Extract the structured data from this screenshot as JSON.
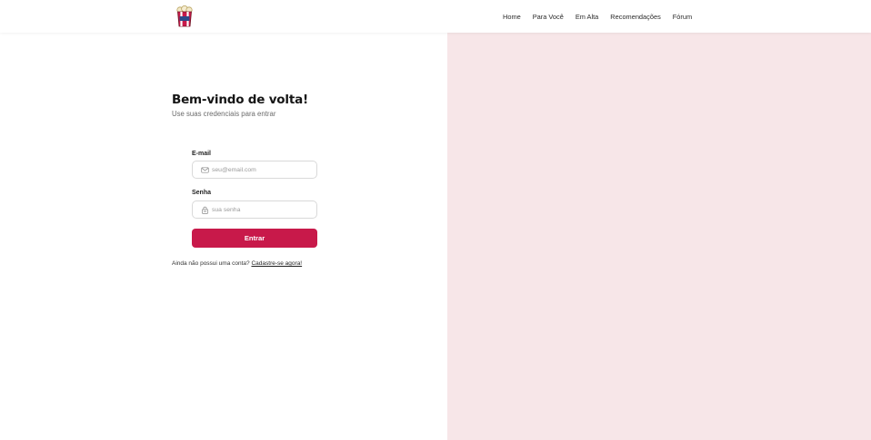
{
  "nav": {
    "logo_icon": "popcorn-box-icon",
    "links": [
      {
        "label": "Home"
      },
      {
        "label": "Para Você"
      },
      {
        "label": "Em Alta"
      },
      {
        "label": "Recomendações"
      },
      {
        "label": "Fórum"
      }
    ]
  },
  "login": {
    "title": "Bem-vindo de volta!",
    "subtitle": "Use suas credenciais para entrar",
    "email": {
      "label": "E-mail",
      "value": "",
      "placeholder": "seu@email.com",
      "icon": "envelope-icon"
    },
    "password": {
      "label": "Senha",
      "value": "",
      "placeholder": "sua senha",
      "icon": "lock-icon"
    },
    "submit_label": "Entrar",
    "signup_prompt": "Ainda não possui uma conta?",
    "signup_link": "Cadastre-se agora!"
  },
  "colors": {
    "accent": "#c8194a",
    "panel": "#f7e6e8"
  }
}
